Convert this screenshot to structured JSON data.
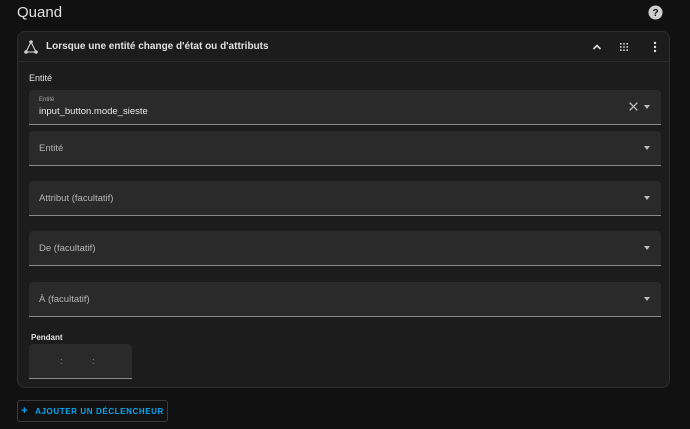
{
  "section": {
    "title": "Quand",
    "help_icon": "help-circle-icon"
  },
  "trigger_card": {
    "icon": "state-change-icon",
    "title": "Lorsque une entité change d'état ou d'attributs",
    "header_icons": [
      "chevron-up-icon",
      "drag-handle-icon",
      "more-vertical-icon"
    ],
    "entity_section_label": "Entité",
    "fields": [
      {
        "label": "Entité",
        "value": "input_button.mode_sieste",
        "clearable": true
      },
      {
        "placeholder": "Entité"
      },
      {
        "placeholder": "Attribut (facultatif)"
      },
      {
        "placeholder": "De (facultatif)"
      },
      {
        "placeholder": "À (facultatif)"
      }
    ],
    "duration": {
      "label": "Pendant",
      "separator": ":"
    }
  },
  "add_button": {
    "label": "AJOUTER UN DÉCLENCHEUR",
    "icon": "plus-icon",
    "accent_color": "#03a9f4"
  }
}
